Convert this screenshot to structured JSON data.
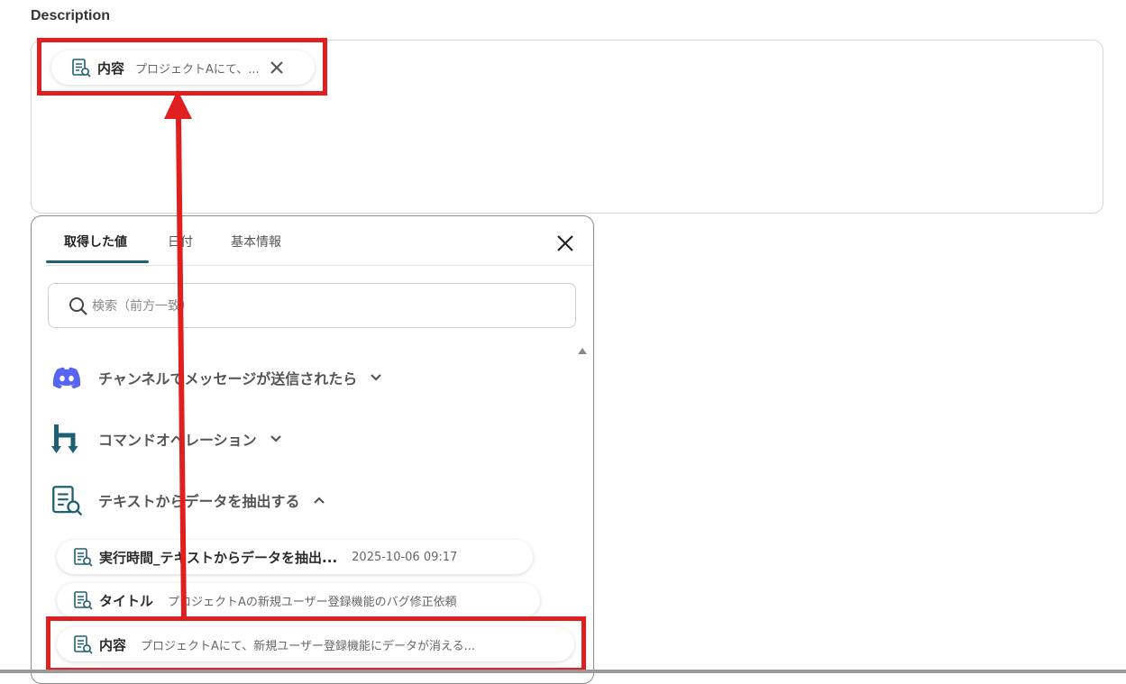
{
  "description": {
    "label": "Description",
    "chip": {
      "name": "内容",
      "value": "プロジェクトAにて、..."
    }
  },
  "panel": {
    "tabs": [
      {
        "label": "取得した値",
        "active": true
      },
      {
        "label": "日付",
        "active": false
      },
      {
        "label": "基本情報",
        "active": false
      }
    ],
    "search": {
      "placeholder": "検索（前方一致）",
      "value": ""
    },
    "groups": [
      {
        "title": "チャンネルでメッセージが送信されたら",
        "icon": "discord-icon",
        "expanded": false
      },
      {
        "title": "コマンドオペレーション",
        "icon": "yoom-command-icon",
        "expanded": false
      },
      {
        "title": "テキストからデータを抽出する",
        "icon": "text-extract-icon",
        "expanded": true
      }
    ],
    "items": [
      {
        "name": "実行時間_テキストからデータを抽出...",
        "value": "2025-10-06 09:17"
      },
      {
        "name": "タイトル",
        "value": "プロジェクトAの新規ユーザー登録機能のバグ修正依頼"
      },
      {
        "name": "内容",
        "value": "プロジェクトAにて、新規ユーザー登録機能にデータが消える..."
      }
    ]
  },
  "colors": {
    "accent": "#1d5f73",
    "highlight": "#e02020",
    "discord": "#5865f2"
  }
}
